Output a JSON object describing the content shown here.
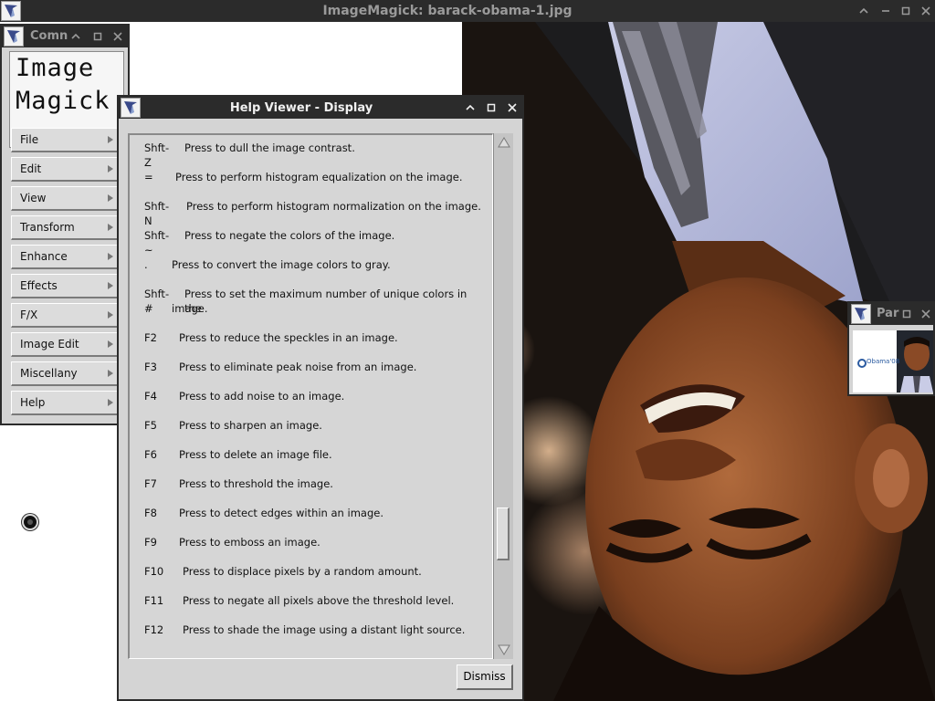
{
  "main_window": {
    "title": "ImageMagick: barack-obama-1.jpg",
    "photo_icon": "person-photo-upside-down"
  },
  "commands_window": {
    "title": "Comn",
    "logo_line1": "Image",
    "logo_line2": "Magick",
    "menu": [
      {
        "label": "File"
      },
      {
        "label": "Edit"
      },
      {
        "label": "View"
      },
      {
        "label": "Transform"
      },
      {
        "label": "Enhance"
      },
      {
        "label": "Effects"
      },
      {
        "label": "F/X"
      },
      {
        "label": "Image Edit"
      },
      {
        "label": "Miscellany"
      },
      {
        "label": "Help"
      }
    ]
  },
  "help_viewer": {
    "title": "Help Viewer - Display",
    "entries": [
      {
        "key": "Shft-Z",
        "desc": "Press to dull the image contrast."
      },
      {
        "key": "=",
        "desc": "Press to perform histogram equalization on the image."
      },
      {
        "key": "Shft-N",
        "desc": "Press to perform histogram normalization on the image."
      },
      {
        "key": "Shft-~",
        "desc": "Press to negate the colors of the image."
      },
      {
        "key": ".",
        "desc": "Press to convert the image colors to gray."
      },
      {
        "key": "Shft-#",
        "desc": "Press to set the maximum number of unique colors in the",
        "desc2": "image."
      },
      {
        "key": "F2",
        "desc": "Press to reduce the speckles in an image."
      },
      {
        "key": "F3",
        "desc": "Press to eliminate peak noise from an image."
      },
      {
        "key": "F4",
        "desc": "Press to add noise to an image."
      },
      {
        "key": "F5",
        "desc": "Press to sharpen an image."
      },
      {
        "key": "F6",
        "desc": "Press to delete an image file."
      },
      {
        "key": "F7",
        "desc": "Press to threshold the image."
      },
      {
        "key": "F8",
        "desc": "Press to detect edges within an image."
      },
      {
        "key": "F9",
        "desc": "Press to emboss an image."
      },
      {
        "key": "F10",
        "desc": "Press to displace pixels by a random amount."
      },
      {
        "key": "F11",
        "desc": "Press to negate all pixels above the threshold level."
      },
      {
        "key": "F12",
        "desc": "Press to shade the image using a distant light source."
      }
    ],
    "dismiss_label": "Dismiss"
  },
  "pan_window": {
    "title": "Par",
    "thumb_logo": "Obama'08"
  },
  "colors": {
    "titlebar": "#2b2b2b",
    "widget_bg": "#d4d4d4"
  }
}
